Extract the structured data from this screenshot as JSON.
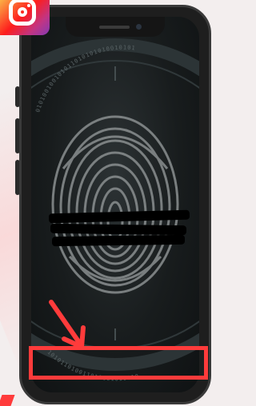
{
  "image": {
    "description_icons": {
      "social_badge": "instagram-icon",
      "scanner_graphic": "fingerprint-icon"
    },
    "binary_ring_top": "010100100101011010101010010101",
    "binary_ring_bottom": "101011010011010001010010"
  },
  "colors": {
    "highlight": "#ff3b3b",
    "screen_bg": "#181c1d",
    "fingerprint": "#8a8f90"
  }
}
